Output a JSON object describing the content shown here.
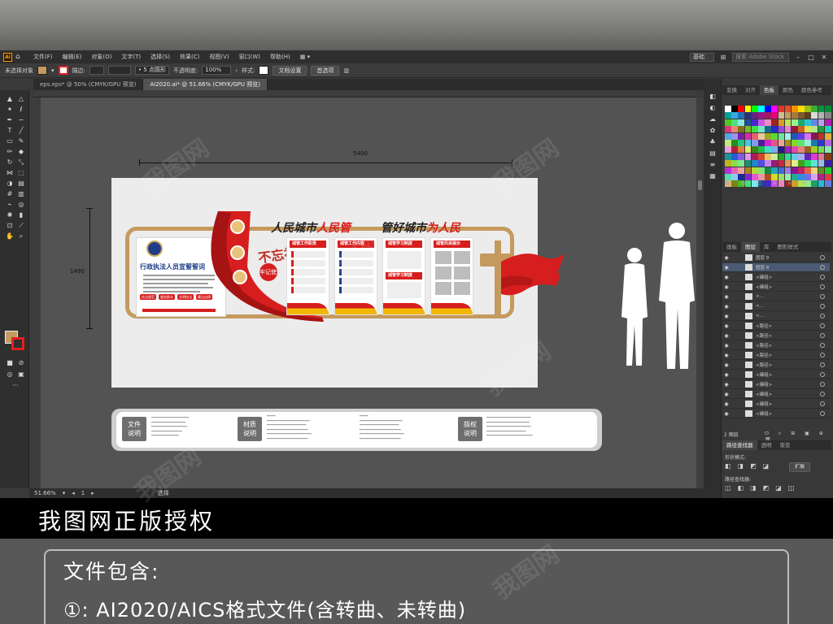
{
  "menubar": {
    "app_icon": "Ai",
    "items": [
      "文件(F)",
      "编辑(E)",
      "对象(O)",
      "文字(T)",
      "选择(S)",
      "效果(C)",
      "视图(V)",
      "窗口(W)",
      "帮助(H)"
    ],
    "workspace": "基础",
    "stock_search": "搜索 Adobe Stock"
  },
  "controlbar": {
    "selection_label": "未选择对象",
    "stroke_label": "描边:",
    "brush_label": "5 点圆形",
    "opacity_label": "不透明度:",
    "opacity_value": "100%",
    "style_label": "样式:",
    "doc_settings": "文档设置",
    "preferences": "首选项"
  },
  "tabs": [
    {
      "label": "eps.eps* @ 50% (CMYK/GPU 预览)"
    },
    {
      "label": "AI2020.ai* @ 51.66% (CMYK/GPU 预览)"
    }
  ],
  "canvas": {
    "width_dim": "5400",
    "height_dim": "1490",
    "left_card_title": "行政执法人员宣誓誓词",
    "slogan_left_a": "人民城市",
    "slogan_left_b": "人民管",
    "slogan_right_a": "管好城市",
    "slogan_right_b": "为人民",
    "calligraphy": "不忘初心",
    "calligraphy_sub": "牢记使命",
    "panels": [
      {
        "head": "城管工作职责"
      },
      {
        "head": "城管工作内容"
      },
      {
        "head": "城管学习制度"
      },
      {
        "head": "城管风采展示"
      }
    ],
    "panel3_sub": "城管学习制度",
    "left_pills": [
      "执法规范",
      "服务群众",
      "文明执法",
      "廉洁自律"
    ]
  },
  "info_bar": {
    "box1": "文件\n说明",
    "box2": "材质\n说明",
    "box3": "版权\n说明",
    "box1_a": "文件",
    "box1_b": "说明",
    "box2_a": "材质",
    "box2_b": "说明",
    "box3_a": "版权",
    "box3_b": "说明"
  },
  "statusbar": {
    "zoom": "51.66%",
    "page": "1",
    "tool": "选择"
  },
  "right_panel": {
    "top_tabs": [
      "变换",
      "对齐",
      "色板",
      "颜色",
      "颜色参考"
    ],
    "layer_tabs": [
      "画板",
      "图层",
      "库",
      "图形样式"
    ],
    "layers": [
      {
        "name": "图层 9",
        "selected": false
      },
      {
        "name": "图层 8",
        "selected": true
      },
      {
        "name": "<编组>",
        "selected": false
      },
      {
        "name": "<编组>",
        "selected": false
      },
      {
        "name": "<...",
        "selected": false
      },
      {
        "name": "<...",
        "selected": false
      },
      {
        "name": "<...",
        "selected": false
      },
      {
        "name": "<路径>",
        "selected": false
      },
      {
        "name": "<路径>",
        "selected": false
      },
      {
        "name": "<路径>",
        "selected": false
      },
      {
        "name": "<路径>",
        "selected": false
      },
      {
        "name": "<路径>",
        "selected": false
      },
      {
        "name": "<编组>",
        "selected": false
      },
      {
        "name": "<编组>",
        "selected": false
      },
      {
        "name": "<编组>",
        "selected": false
      },
      {
        "name": "<编组>",
        "selected": false
      },
      {
        "name": "<编组>",
        "selected": false
      }
    ],
    "layer_count": "2 图层",
    "pathfinder_tabs": [
      "路径查找器",
      "透明",
      "渐变"
    ],
    "shape_mode_label": "形状模式:",
    "expand_btn": "扩展",
    "pathfinder_label": "路径查找器:"
  },
  "footer": {
    "title": "我图网正版授权",
    "subtitle": "文件包含:",
    "item": "①: AI2020/AICS格式文件(含转曲、未转曲)",
    "watermark": "我图网"
  },
  "colors": {
    "accent_red": "#d71e1e",
    "gold": "#c49a5e",
    "app_bg": "#535353"
  }
}
